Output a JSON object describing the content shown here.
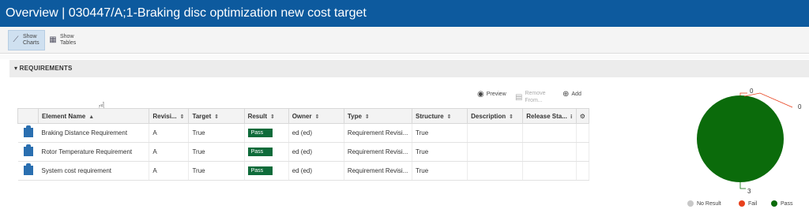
{
  "window": {
    "title": "Overview | 030447/A;1-Braking disc optimization new cost target"
  },
  "toolbar": {
    "show_charts": "Show Charts",
    "show_tables": "Show Tables"
  },
  "section": {
    "title": "REQUIREMENTS",
    "toggle": "▾"
  },
  "actions": {
    "preview": "Preview",
    "remove_from": "Remove From...",
    "add": "Add"
  },
  "table": {
    "columns": [
      "Element Name",
      "Revisi...",
      "Target",
      "Result",
      "Owner",
      "Type",
      "Structure",
      "Description",
      "Release Sta..."
    ],
    "rows": [
      {
        "name": "Braking Distance Requirement",
        "revision": "A",
        "target": "True",
        "result": "Pass",
        "owner": "ed (ed)",
        "type": "Requirement Revisi...",
        "structure": "True",
        "description": "",
        "release": ""
      },
      {
        "name": "Rotor Temperature Requirement",
        "revision": "A",
        "target": "True",
        "result": "Pass",
        "owner": "ed (ed)",
        "type": "Requirement Revisi...",
        "structure": "True",
        "description": "",
        "release": ""
      },
      {
        "name": "System cost requirement",
        "revision": "A",
        "target": "True",
        "result": "Pass",
        "owner": "ed (ed)",
        "type": "Requirement Revisi...",
        "structure": "True",
        "description": "",
        "release": ""
      }
    ]
  },
  "chart_data": {
    "type": "pie",
    "categories": [
      "No Result",
      "Fail",
      "Pass"
    ],
    "values": [
      0,
      0,
      3
    ],
    "colors": [
      "#c8c8c8",
      "#e8401c",
      "#0b6b0b"
    ],
    "data_labels": [
      "0",
      "0",
      "3"
    ],
    "legend_position": "bottom"
  },
  "colors": {
    "titlebar": "#0d5a9e",
    "pass_badge": "#0e6b3a",
    "accent": "#1a5fa0"
  }
}
